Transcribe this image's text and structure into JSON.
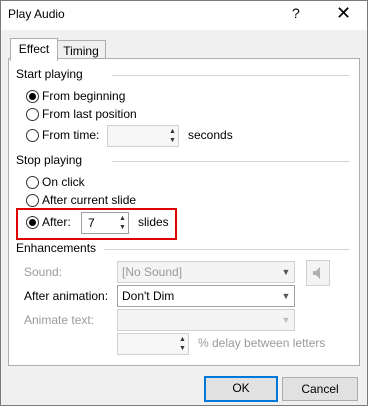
{
  "window": {
    "title": "Play Audio",
    "help_label": "?",
    "close_label": "✕"
  },
  "tabs": [
    {
      "label": "Effect",
      "active": true
    },
    {
      "label": "Timing",
      "active": false
    }
  ],
  "start_playing": {
    "label": "Start playing",
    "from_beginning": "From beginning",
    "from_last_position": "From last position",
    "from_time": "From time:",
    "time_value": "",
    "seconds_label": "seconds",
    "selected": "from_beginning"
  },
  "stop_playing": {
    "label": "Stop playing",
    "on_click": "On click",
    "after_current_slide": "After current slide",
    "after": "After:",
    "after_value": "7",
    "slides_label": "slides",
    "selected": "after"
  },
  "enhancements": {
    "label": "Enhancements",
    "sound_label": "Sound:",
    "sound_value": "[No Sound]",
    "after_animation_label": "After animation:",
    "after_animation_value": "Don't Dim",
    "animate_text_label": "Animate text:",
    "animate_text_value": "",
    "delay_value": "",
    "delay_label": "% delay between letters"
  },
  "buttons": {
    "ok": "OK",
    "cancel": "Cancel"
  },
  "icons": {
    "speaker": "speaker-icon",
    "spin_up": "chevron-up-icon",
    "spin_down": "chevron-down-icon",
    "combo_arrow": "chevron-down-icon"
  },
  "colors": {
    "highlight": "#e00000",
    "default_button": "#0078d7"
  }
}
